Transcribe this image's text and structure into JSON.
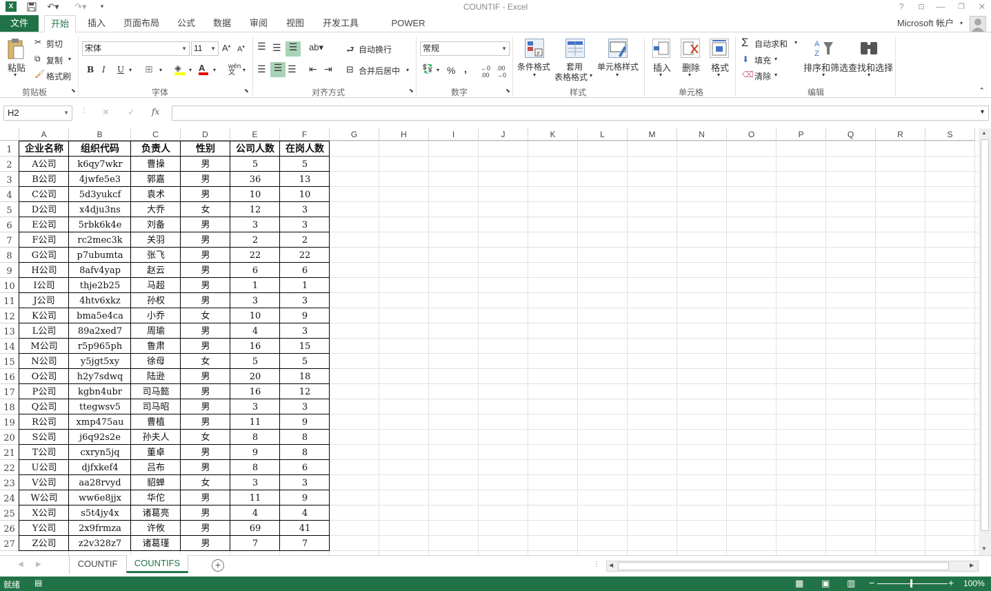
{
  "window": {
    "title": "COUNTIF - Excel",
    "help": "?",
    "account": "Microsoft 帐户"
  },
  "tabs": [
    "文件",
    "开始",
    "插入",
    "页面布局",
    "公式",
    "数据",
    "审阅",
    "视图",
    "开发工具",
    "POWER QUERY"
  ],
  "ribbon": {
    "clipboard": {
      "paste": "粘贴",
      "cut": "剪切",
      "copy": "复制",
      "painter": "格式刷",
      "label": "剪贴板"
    },
    "font": {
      "name": "宋体",
      "size": "11",
      "bold": "B",
      "italic": "I",
      "underline": "U",
      "label": "字体"
    },
    "alignment": {
      "wrap": "自动换行",
      "merge": "合并后居中",
      "label": "对齐方式"
    },
    "number": {
      "format": "常规",
      "percent": "%",
      "comma": ",",
      "label": "数字"
    },
    "styles": {
      "conditional": "条件格式",
      "table_line1": "套用",
      "table_line2": "表格格式",
      "cell_styles": "单元格样式",
      "label": "样式"
    },
    "cells": {
      "insert": "插入",
      "delete": "删除",
      "format": "格式",
      "label": "单元格"
    },
    "editing": {
      "autosum": "自动求和",
      "fill": "填充",
      "clear": "清除",
      "sort": "排序和筛选",
      "find": "查找和选择",
      "label": "编辑"
    }
  },
  "formula_bar": {
    "name_box": "H2",
    "fx": "fx",
    "value": ""
  },
  "columns": [
    "A",
    "B",
    "C",
    "D",
    "E",
    "F",
    "G",
    "H",
    "I",
    "J",
    "K",
    "L",
    "M",
    "N",
    "O",
    "P",
    "Q",
    "R",
    "S"
  ],
  "rows": [
    "1",
    "2",
    "3",
    "4",
    "5",
    "6",
    "7",
    "8",
    "9",
    "10",
    "11",
    "12",
    "13",
    "14",
    "15",
    "16",
    "17",
    "18",
    "19",
    "20",
    "21",
    "22",
    "23",
    "24",
    "25",
    "26",
    "27"
  ],
  "table": {
    "headers": [
      "企业名称",
      "组织代码",
      "负责人",
      "性别",
      "公司人数",
      "在岗人数"
    ],
    "data": [
      [
        "A公司",
        "k6qy7wkr",
        "曹操",
        "男",
        "5",
        "5"
      ],
      [
        "B公司",
        "4jwfe5e3",
        "郭嘉",
        "男",
        "36",
        "13"
      ],
      [
        "C公司",
        "5d3yukcf",
        "袁术",
        "男",
        "10",
        "10"
      ],
      [
        "D公司",
        "x4dju3ns",
        "大乔",
        "女",
        "12",
        "3"
      ],
      [
        "E公司",
        "5rbk6k4e",
        "刘备",
        "男",
        "3",
        "3"
      ],
      [
        "F公司",
        "rc2mec3k",
        "关羽",
        "男",
        "2",
        "2"
      ],
      [
        "G公司",
        "p7ubumta",
        "张飞",
        "男",
        "22",
        "22"
      ],
      [
        "H公司",
        "8afv4yap",
        "赵云",
        "男",
        "6",
        "6"
      ],
      [
        "I公司",
        "thje2b25",
        "马超",
        "男",
        "1",
        "1"
      ],
      [
        "J公司",
        "4htv6xkz",
        "孙权",
        "男",
        "3",
        "3"
      ],
      [
        "K公司",
        "bma5e4ca",
        "小乔",
        "女",
        "10",
        "9"
      ],
      [
        "L公司",
        "89a2xed7",
        "周瑜",
        "男",
        "4",
        "3"
      ],
      [
        "M公司",
        "r5p965ph",
        "鲁肃",
        "男",
        "16",
        "15"
      ],
      [
        "N公司",
        "y5jgt5xy",
        "徐母",
        "女",
        "5",
        "5"
      ],
      [
        "O公司",
        "h2y7sdwq",
        "陆逊",
        "男",
        "20",
        "18"
      ],
      [
        "P公司",
        "kgbn4ubr",
        "司马懿",
        "男",
        "16",
        "12"
      ],
      [
        "Q公司",
        "ttegwsv5",
        "司马昭",
        "男",
        "3",
        "3"
      ],
      [
        "R公司",
        "xmp475au",
        "曹植",
        "男",
        "11",
        "9"
      ],
      [
        "S公司",
        "j6q92s2e",
        "孙夫人",
        "女",
        "8",
        "8"
      ],
      [
        "T公司",
        "cxryn5jq",
        "董卓",
        "男",
        "9",
        "8"
      ],
      [
        "U公司",
        "djfxkef4",
        "吕布",
        "男",
        "8",
        "6"
      ],
      [
        "V公司",
        "aa28rvyd",
        "貂蝉",
        "女",
        "3",
        "3"
      ],
      [
        "W公司",
        "ww6e8jjx",
        "华佗",
        "男",
        "11",
        "9"
      ],
      [
        "X公司",
        "s5t4jy4x",
        "诸葛亮",
        "男",
        "4",
        "4"
      ],
      [
        "Y公司",
        "2x9frmza",
        "许攸",
        "男",
        "69",
        "41"
      ],
      [
        "Z公司",
        "z2v328z7",
        "诸葛瑾",
        "男",
        "7",
        "7"
      ]
    ]
  },
  "sheets": [
    "COUNTIF",
    "COUNTIFS"
  ],
  "active_sheet": "COUNTIFS",
  "status": {
    "ready": "就绪",
    "zoom": "100%"
  },
  "colors": {
    "accent": "#217346",
    "grid": "#e1e1e1"
  }
}
